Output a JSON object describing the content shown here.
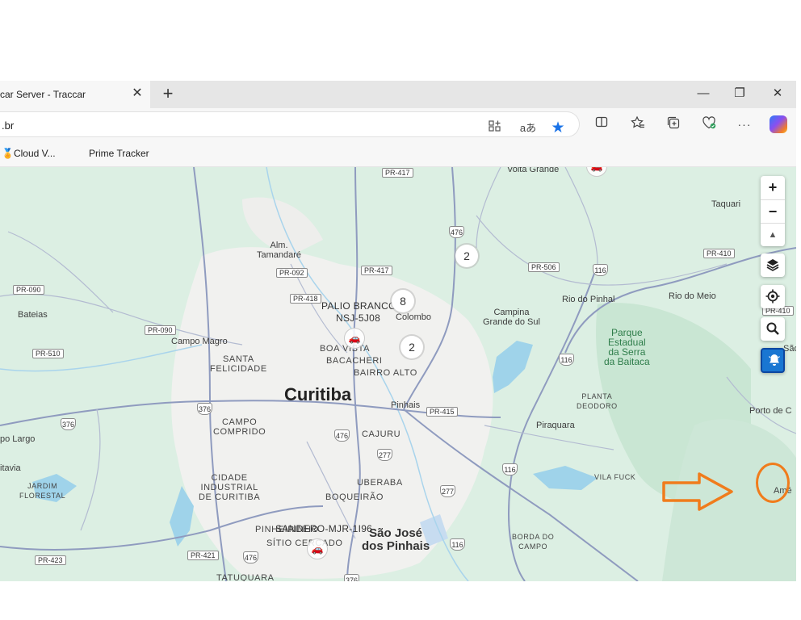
{
  "browser": {
    "tab_title": "car Server - Traccar",
    "tab_close": "✕",
    "new_tab": "+",
    "window_controls": {
      "minimize": "—",
      "restore": "❐",
      "close": "✕"
    },
    "url": ".br",
    "toolbar_icons": [
      "apps-icon",
      "read-aloud-icon",
      "favorite-star-icon",
      "split-screen-icon",
      "favorites-icon",
      "collections-icon",
      "browser-essentials-icon",
      "more-icon",
      "copilot-icon"
    ],
    "read_aloud_glyph": "aあ",
    "more_glyph": "···",
    "favorites": [
      {
        "label": "Cloud V..."
      },
      {
        "label": "Prime Tracker"
      }
    ]
  },
  "map": {
    "city": "Curitiba",
    "labels": {
      "volta_grande": "Volta Grande",
      "taquari": "Taquari",
      "alm_tamandare": "Alm.\nTamandaré",
      "bateias": "Bateias",
      "campo_magro": "Campo Magro",
      "palio_branco": "PALIO BRANCO",
      "nsj": "NSJ-5J08",
      "colombo": "Colombo",
      "campina": "Campina\nGrande do Sul",
      "rio_do_pinhal": "Rio do Pinhal",
      "rio_do_meio": "Rio do Meio",
      "parque": "Parque\nEstadual\nda Serra\nda Baitaca",
      "santa_felicidade": "SANTA\nFELICIDADE",
      "boa_vista": "BOA VISTA",
      "bacacheri": "BACACHERI",
      "bairro_alto": "BAIRRO ALTO",
      "pinhais": "Pinhais",
      "planta_deodoro": "PLANTA\nDEODORO",
      "porto_de": "Porto de C",
      "campo_comprido": "CAMPO\nCOMPRIDO",
      "cajuru": "CAJURU",
      "piraquara": "Piraquara",
      "po_largo": "po Largo",
      "itavia": "itavia",
      "jardim_florestal": "JARDIM\nFLORESTAL",
      "cidade_industrial": "CIDADE\nINDUSTRIAL\nDE CURITIBA",
      "uberaba": "UBERABA",
      "boqueirao": "BOQUEIRÃO",
      "vila_fuck": "VILA FUCK",
      "ame": "Amé",
      "pinheirinho": "PINHEIRINHO",
      "sitio_cercado": "SÍTIO CERCADO",
      "sandero": "SANDERO-MJR-1I96",
      "sao_jose": "São José\ndos Pinhais",
      "borda_do_campo": "BORDA DO\nCAMPO",
      "tatuquara": "TATUQUARA",
      "sao": "São"
    },
    "road_shields": [
      "PR-417",
      "PR-417",
      "PR-092",
      "PR-090",
      "PR-090",
      "PR-418",
      "PR-510",
      "PR-506",
      "PR-410",
      "PR-410",
      "PR-415",
      "PR-421",
      "PR-423"
    ],
    "highway_shields": [
      "476",
      "116",
      "116",
      "376",
      "376",
      "476",
      "277",
      "277",
      "116",
      "116",
      "476",
      "376"
    ],
    "clusters": [
      "2",
      "8",
      "2"
    ],
    "controls": {
      "zoom_in": "+",
      "zoom_out": "−",
      "compass": "▲",
      "layers": "≋",
      "locate": "◎",
      "search": "⌕",
      "notifications": "🔔"
    }
  }
}
